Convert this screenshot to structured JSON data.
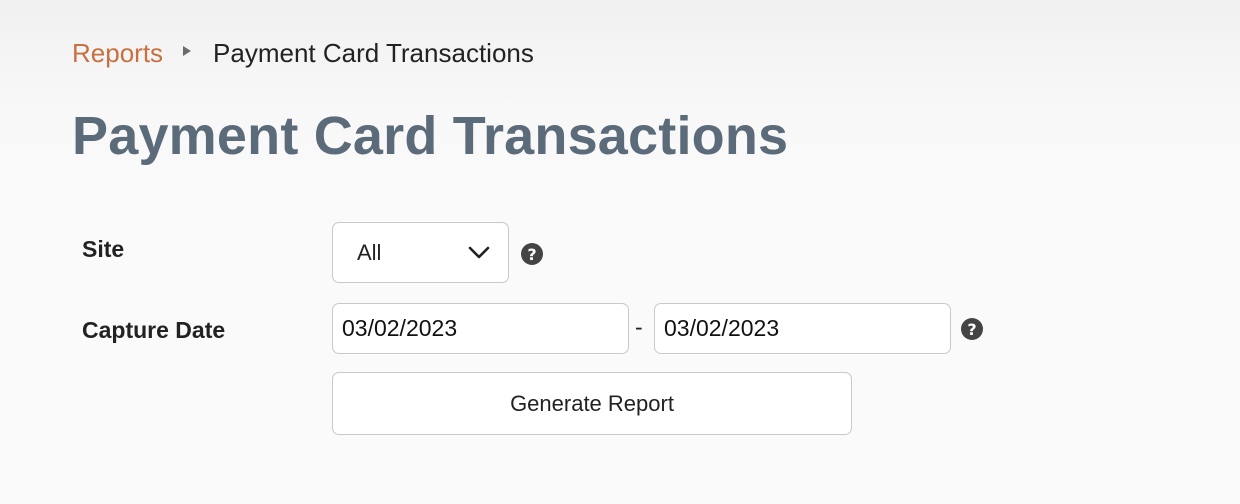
{
  "breadcrumb": {
    "parent_label": "Reports",
    "current_label": "Payment Card Transactions"
  },
  "page": {
    "title": "Payment Card Transactions"
  },
  "form": {
    "site": {
      "label": "Site",
      "selected_value": "All",
      "help_icon": "question-circle-icon"
    },
    "capture_date": {
      "label": "Capture Date",
      "from_value": "03/02/2023",
      "separator": "-",
      "to_value": "03/02/2023",
      "help_icon": "question-circle-icon"
    },
    "generate_label": "Generate Report"
  },
  "colors": {
    "link": "#c8703f",
    "title": "#5c6b7a",
    "border": "#c9c9c9"
  }
}
